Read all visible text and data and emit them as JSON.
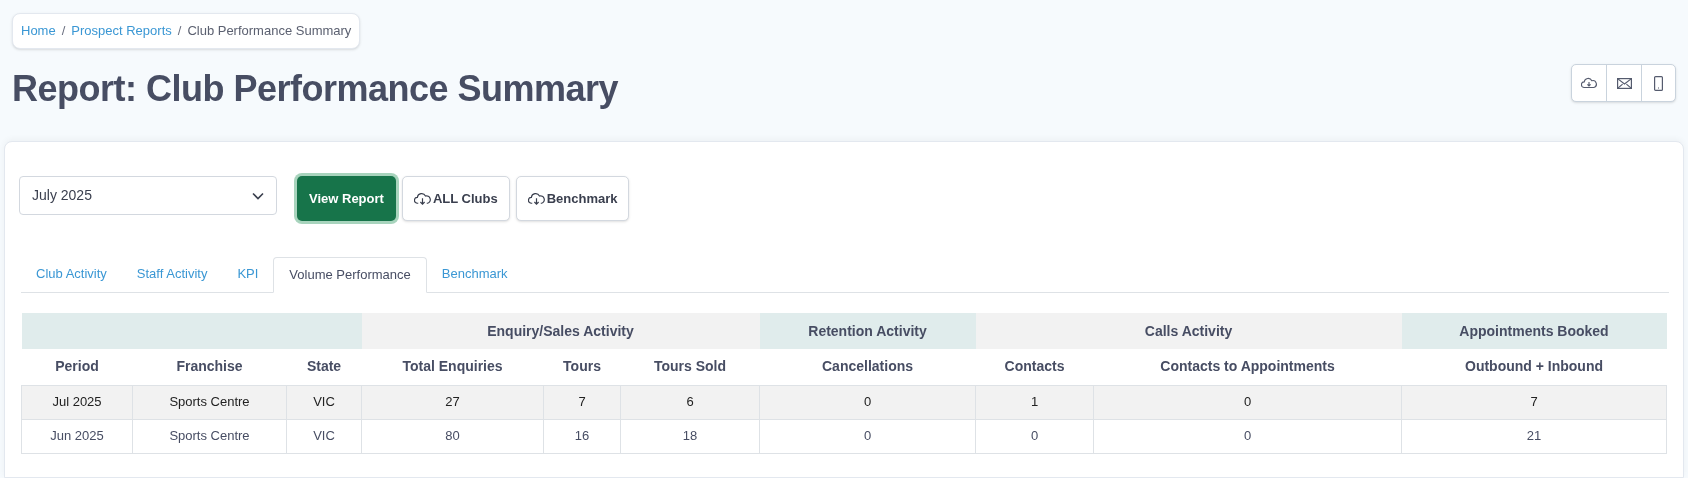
{
  "breadcrumb": [
    {
      "label": "Home",
      "link": true
    },
    {
      "label": "Prospect Reports",
      "link": true
    },
    {
      "label": "Club Performance Summary",
      "link": false
    }
  ],
  "breadcrumb_separator": "/",
  "title": "Report: Club Performance Summary",
  "period_select": {
    "value": "July 2025"
  },
  "buttons": [
    {
      "label": "View Report",
      "kind": "primary"
    },
    {
      "label": "ALL Clubs",
      "kind": "download"
    },
    {
      "label": "Benchmark",
      "kind": "download"
    }
  ],
  "tabs": [
    {
      "label": "Club Activity",
      "selected": false
    },
    {
      "label": "Staff Activity",
      "selected": false
    },
    {
      "label": "KPI",
      "selected": false
    },
    {
      "label": "Volume Performance",
      "selected": true
    },
    {
      "label": "Benchmark",
      "selected": false
    }
  ],
  "table": {
    "groups": [
      {
        "columns": [
          "Period",
          "Franchise",
          "State"
        ]
      },
      {
        "label": "Enquiry/Sales Activity",
        "columns": [
          "Total Enquiries",
          "Tours",
          "Tours Sold"
        ]
      },
      {
        "label": "Retention Activity",
        "columns": [
          "Cancellations"
        ]
      },
      {
        "label": "Calls Activity",
        "columns": [
          "Contacts",
          "Contacts to Appointments"
        ]
      },
      {
        "label": "Appointments Booked",
        "columns": [
          "Outbound + Inbound"
        ]
      }
    ],
    "rows": [
      [
        "Jul 2025",
        "Sports Centre",
        "VIC",
        "27",
        "7",
        "6",
        "0",
        "1",
        "0",
        "7"
      ],
      [
        "Jun 2025",
        "Sports Centre",
        "VIC",
        "80",
        "16",
        "18",
        "0",
        "0",
        "0",
        "21"
      ]
    ]
  }
}
